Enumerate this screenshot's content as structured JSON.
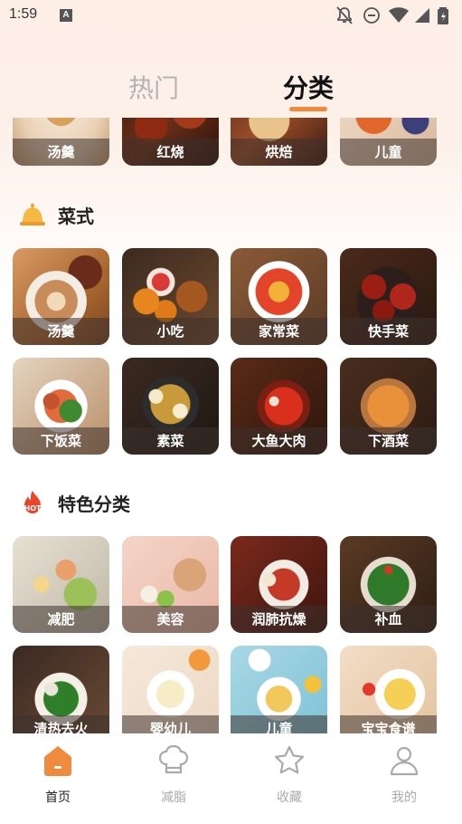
{
  "status_bar": {
    "time": "1:59",
    "a_icon": "A"
  },
  "tabs": [
    {
      "label": "热门"
    },
    {
      "label": "分类"
    }
  ],
  "top_row": [
    {
      "label": "汤羹"
    },
    {
      "label": "红烧"
    },
    {
      "label": "烘焙"
    },
    {
      "label": "儿童"
    }
  ],
  "sections": [
    {
      "title": "菜式",
      "icon": "bell-icon",
      "items": [
        {
          "label": "汤羹"
        },
        {
          "label": "小吃"
        },
        {
          "label": "家常菜"
        },
        {
          "label": "快手菜"
        },
        {
          "label": "下饭菜"
        },
        {
          "label": "素菜"
        },
        {
          "label": "大鱼大肉"
        },
        {
          "label": "下酒菜"
        }
      ]
    },
    {
      "title": "特色分类",
      "icon": "hot-icon",
      "icon_text": "HOT",
      "items": [
        {
          "label": "减肥"
        },
        {
          "label": "美容"
        },
        {
          "label": "润肺抗燥"
        },
        {
          "label": "补血"
        },
        {
          "label": "清热去火"
        },
        {
          "label": "婴幼儿"
        },
        {
          "label": "儿童"
        },
        {
          "label": "宝宝食谱"
        }
      ]
    }
  ],
  "nav": [
    {
      "label": "首页",
      "icon": "home-icon",
      "active": true
    },
    {
      "label": "减脂",
      "icon": "chef-hat-icon",
      "active": false
    },
    {
      "label": "收藏",
      "icon": "star-icon",
      "active": false
    },
    {
      "label": "我的",
      "icon": "user-icon",
      "active": false
    }
  ],
  "colors": {
    "accent": "#f08a3c",
    "hot": "#e8452c"
  }
}
